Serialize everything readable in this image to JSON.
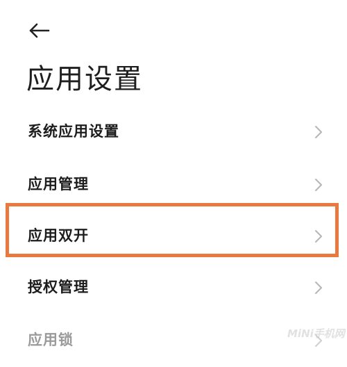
{
  "page": {
    "title": "应用设置"
  },
  "menu": {
    "items": [
      {
        "label": "系统应用设置"
      },
      {
        "label": "应用管理"
      },
      {
        "label": "应用双开"
      },
      {
        "label": "授权管理"
      },
      {
        "label": "应用锁"
      }
    ]
  },
  "watermark": {
    "text": "MiNi手机网"
  },
  "colors": {
    "highlight": "#e9793f",
    "text": "#1c1c1c",
    "faded_text": "#9a9a9a",
    "chevron": "#b5b5b5"
  },
  "icons": {
    "back": "arrow-left-icon",
    "row": "chevron-right-icon"
  }
}
